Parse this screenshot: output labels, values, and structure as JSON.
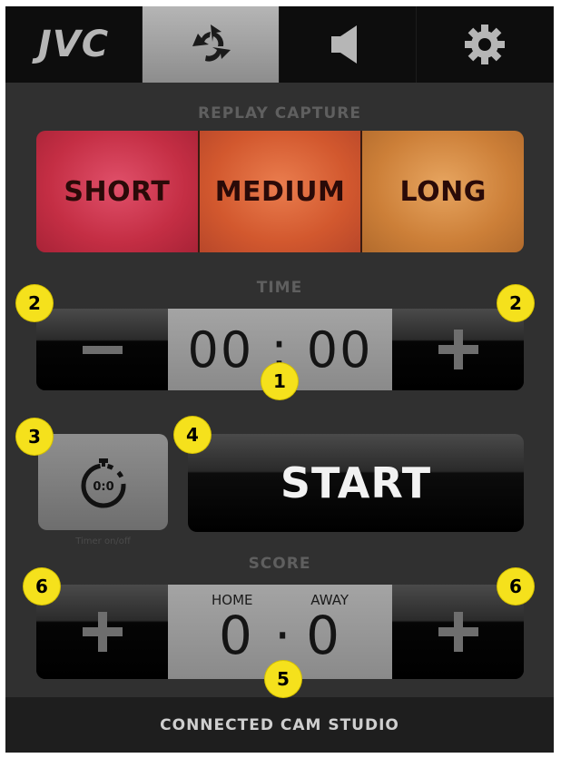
{
  "tabs": [
    {
      "label": "JVC",
      "icon": "jvc-logo",
      "active": false
    },
    {
      "label": "",
      "icon": "replay-cycle-icon",
      "active": true
    },
    {
      "label": "",
      "icon": "speaker-icon",
      "active": false
    },
    {
      "label": "",
      "icon": "gear-icon",
      "active": false
    }
  ],
  "replay_capture": {
    "label": "REPLAY CAPTURE",
    "buttons": [
      "SHORT",
      "MEDIUM",
      "LONG"
    ],
    "colors": [
      "#c42e44",
      "#d2582e",
      "#cc7f38"
    ]
  },
  "time": {
    "label": "TIME",
    "minus": "−",
    "plus": "+",
    "value": "00 : 00"
  },
  "timer": {
    "icon_text": "0:0",
    "caption": "Timer on/off"
  },
  "start": {
    "label": "START"
  },
  "score": {
    "label": "SCORE",
    "home_label": "HOME",
    "away_label": "AWAY",
    "home": "0",
    "sep": "·",
    "away": "0",
    "plus_left": "+",
    "plus_right": "+"
  },
  "footer": {
    "label": "CONNECTED CAM STUDIO"
  },
  "markers": {
    "m1": "1",
    "m2a": "2",
    "m2b": "2",
    "m3": "3",
    "m4": "4",
    "m5": "5",
    "m6a": "6",
    "m6b": "6"
  },
  "accent_marker_color": "#f5e11c"
}
